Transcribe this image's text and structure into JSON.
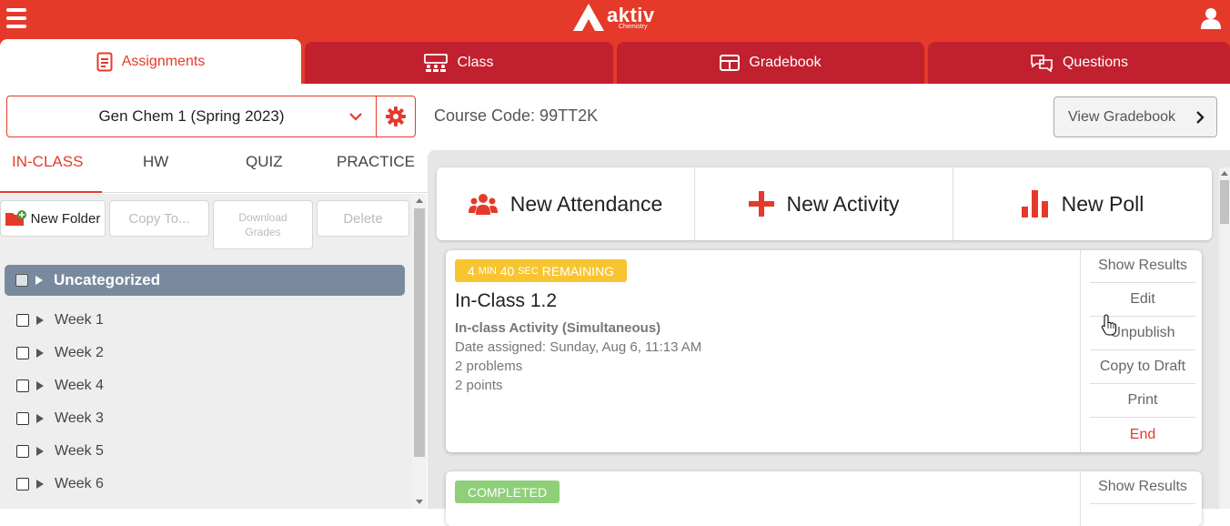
{
  "brand": {
    "name": "aktiv",
    "subtitle": "Chemistry"
  },
  "tabs": [
    {
      "label": "Assignments",
      "icon": "document-icon",
      "active": true
    },
    {
      "label": "Class",
      "icon": "classroom-icon"
    },
    {
      "label": "Gradebook",
      "icon": "table-icon"
    },
    {
      "label": "Questions",
      "icon": "chat-bubbles-icon"
    }
  ],
  "course": {
    "selected": "Gen Chem 1 (Spring 2023)",
    "code_label": "Course Code: 99TT2K"
  },
  "view_gradebook": "View Gradebook",
  "subtabs": [
    "IN-CLASS",
    "HW",
    "QUIZ",
    "PRACTICE"
  ],
  "toolbar": {
    "new_folder": "New Folder",
    "copy_to": "Copy To...",
    "download_grades_1": "Download",
    "download_grades_2": "Grades",
    "delete": "Delete"
  },
  "folders": [
    "Uncategorized",
    "Week 1",
    "Week 2",
    "Week 4",
    "Week 3",
    "Week 5",
    "Week 6"
  ],
  "actions": {
    "new_attendance": "New Attendance",
    "new_activity": "New Activity",
    "new_poll": "New Poll"
  },
  "assignments": [
    {
      "badge_num1": "4",
      "badge_unit1": "MIN",
      "badge_num2": "40",
      "badge_unit2": "SEC",
      "badge_rest": "REMAINING",
      "title": "In-Class 1.2",
      "type": "In-class Activity (Simultaneous)",
      "date": "Date assigned: Sunday, Aug 6, 11:13 AM",
      "problems": "2 problems",
      "points": "2 points",
      "actions": [
        "Show Results",
        "Edit",
        "Unpublish",
        "Copy to Draft",
        "Print",
        "End"
      ]
    },
    {
      "badge": "COMPLETED",
      "actions": [
        "Show Results"
      ]
    }
  ],
  "colors": {
    "brand_red": "#e53a2a",
    "tab_inactive": "#c1202f",
    "folder_selected": "#7a8a9e",
    "badge_yellow": "#f7c531",
    "badge_green": "#8fcf7a"
  }
}
